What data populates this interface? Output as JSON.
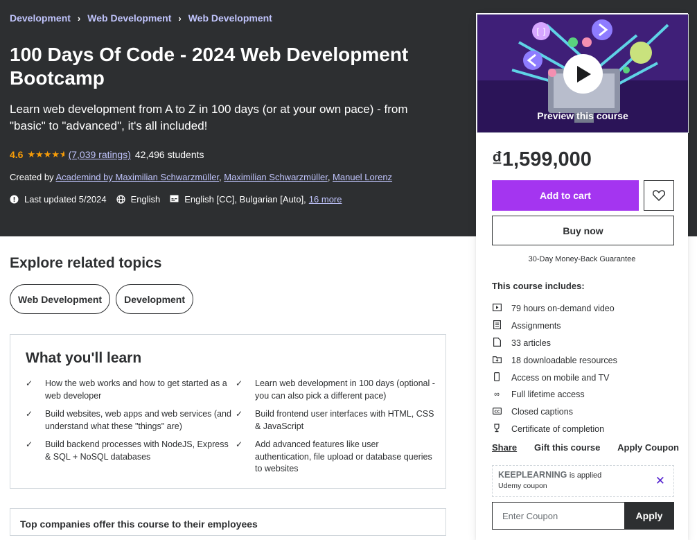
{
  "breadcrumb": [
    "Development",
    "Web Development",
    "Web Development"
  ],
  "breadcrumb_sep": "›",
  "course": {
    "title": "100 Days Of Code - 2024 Web Development Bootcamp",
    "subtitle": "Learn web development from A to Z in 100 days (or at your own pace) - from \"basic\" to \"advanced\", it's all included!",
    "rating": "4.6",
    "stars": 4.5,
    "ratings_count": "(7,039 ratings)",
    "students": "42,496 students",
    "created_by_label": "Created by",
    "authors": [
      "Academind by Maximilian Schwarzmüller",
      "Maximilian Schwarzmüller",
      "Manuel Lorenz"
    ],
    "last_updated": "Last updated 5/2024",
    "language": "English",
    "captions": "English [CC], Bulgarian [Auto],",
    "more_captions": "16 more"
  },
  "explore": {
    "title": "Explore related topics",
    "topics": [
      "Web Development",
      "Development"
    ]
  },
  "learn": {
    "title": "What you'll learn",
    "items": [
      "How the web works and how to get started as a web developer",
      "Learn web development in 100 days (optional - you can also pick a different pace)",
      "Build websites, web apps and web services (and understand what these \"things\" are)",
      "Build frontend user interfaces with HTML, CSS & JavaScript",
      "Build backend processes with NodeJS, Express & SQL + NoSQL databases",
      "Add advanced features like user authentication, file upload or database queries to websites"
    ]
  },
  "companies_title": "Top companies offer this course to their employees",
  "sidebar": {
    "preview_label": "Preview this course",
    "price": "₫1,599,000",
    "add_to_cart": "Add to cart",
    "buy_now": "Buy now",
    "guarantee": "30-Day Money-Back Guarantee",
    "includes_title": "This course includes:",
    "includes": [
      {
        "icon": "video-icon",
        "label": "79 hours on-demand video"
      },
      {
        "icon": "assignment-icon",
        "label": "Assignments"
      },
      {
        "icon": "article-icon",
        "label": "33 articles"
      },
      {
        "icon": "download-icon",
        "label": "18 downloadable resources"
      },
      {
        "icon": "mobile-icon",
        "label": "Access on mobile and TV"
      },
      {
        "icon": "infinity-icon",
        "label": "Full lifetime access"
      },
      {
        "icon": "captions-icon",
        "label": "Closed captions"
      },
      {
        "icon": "trophy-icon",
        "label": "Certificate of completion"
      }
    ],
    "share": "Share",
    "gift": "Gift this course",
    "apply_coupon": "Apply Coupon",
    "coupon_code": "KEEPLEARNING",
    "coupon_applied": "is applied",
    "coupon_sub": "Udemy coupon",
    "coupon_placeholder": "Enter Coupon",
    "apply": "Apply"
  },
  "colors": {
    "hero_bg": "#2d2f31",
    "accent_purple": "#a435f0",
    "link_lavender": "#c0c4fc",
    "star_orange": "#f69c08"
  }
}
